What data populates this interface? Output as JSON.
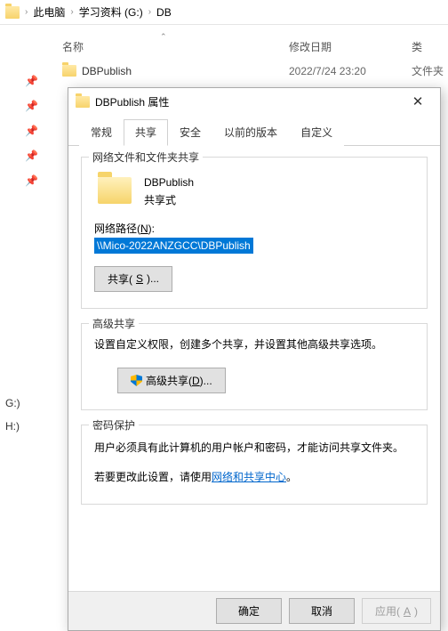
{
  "breadcrumb": {
    "items": [
      "此电脑",
      "学习资料 (G:)",
      "DB"
    ]
  },
  "columns": {
    "name": "名称",
    "date": "修改日期",
    "type": "类"
  },
  "row": {
    "name": "DBPublish",
    "date": "2022/7/24 23:20",
    "type": "文件夹"
  },
  "side": {
    "items": [
      "G:)",
      "H:)"
    ]
  },
  "dialog": {
    "title": "DBPublish 属性",
    "tabs": {
      "general": "常规",
      "share": "共享",
      "security": "安全",
      "prev": "以前的版本",
      "custom": "自定义"
    },
    "group1": {
      "title": "网络文件和文件夹共享",
      "folder_name": "DBPublish",
      "share_state": "共享式",
      "path_label_pre": "网络路径(",
      "path_label_u": "N",
      "path_label_post": "):",
      "net_path": "\\\\Mico-2022ANZGCC\\DBPublish",
      "share_btn_pre": "共享(",
      "share_btn_u": "S",
      "share_btn_post": ")..."
    },
    "group2": {
      "title": "高级共享",
      "desc": "设置自定义权限，创建多个共享，并设置其他高级共享选项。",
      "btn_pre": "高级共享(",
      "btn_u": "D",
      "btn_post": ")..."
    },
    "group3": {
      "title": "密码保护",
      "line1": "用户必须具有此计算机的用户帐户和密码，才能访问共享文件夹。",
      "line2_pre": "若要更改此设置，请使用",
      "link": "网络和共享中心",
      "line2_post": "。"
    },
    "footer": {
      "ok": "确定",
      "cancel": "取消",
      "apply_pre": "应用(",
      "apply_u": "A",
      "apply_post": ")"
    }
  }
}
